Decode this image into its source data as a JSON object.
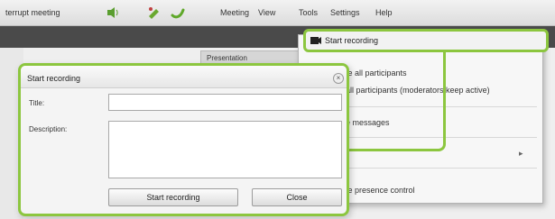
{
  "app": {
    "title": "terrupt meeting"
  },
  "menu": {
    "items": [
      "Meeting",
      "View",
      "Tools",
      "Settings",
      "Help"
    ]
  },
  "toolbar": {
    "icons": [
      "speaker-icon",
      "phone-icon",
      "hangup-icon"
    ]
  },
  "tab": {
    "label": "Presentation"
  },
  "dropdown": {
    "highlighted": "Start recording",
    "items": [
      "te all participants",
      "all participants (moderators keep active)",
      "e messages",
      "te presence control"
    ]
  },
  "dialog": {
    "title": "Start recording",
    "title_label": "Title:",
    "title_value": "",
    "description_label": "Description:",
    "description_value": "",
    "start_button": "Start recording",
    "close_button": "Close",
    "close_symbol": "×"
  },
  "colors": {
    "accent": "#8cc63f",
    "darkbar": "#4a4a4a"
  }
}
